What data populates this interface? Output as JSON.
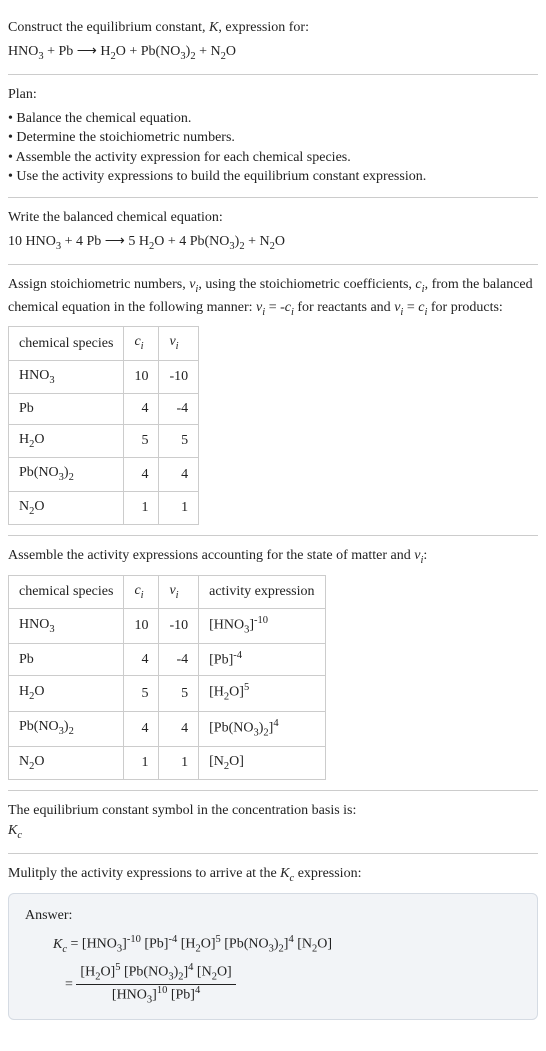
{
  "prompt": {
    "line1": "Construct the equilibrium constant, K, expression for:",
    "equation": "HNO₃ + Pb ⟶ H₂O + Pb(NO₃)₂ + N₂O"
  },
  "plan": {
    "heading": "Plan:",
    "items": [
      "Balance the chemical equation.",
      "Determine the stoichiometric numbers.",
      "Assemble the activity expression for each chemical species.",
      "Use the activity expressions to build the equilibrium constant expression."
    ]
  },
  "balanced": {
    "heading": "Write the balanced chemical equation:",
    "equation": "10 HNO₃ + 4 Pb ⟶ 5 H₂O + 4 Pb(NO₃)₂ + N₂O"
  },
  "stoich": {
    "heading_a": "Assign stoichiometric numbers, νᵢ, using the stoichiometric coefficients, cᵢ, from the balanced chemical equation in the following manner: νᵢ = -cᵢ for reactants and νᵢ = cᵢ for products:",
    "headers": [
      "chemical species",
      "cᵢ",
      "νᵢ"
    ],
    "rows": [
      {
        "species": "HNO₃",
        "c": "10",
        "v": "-10"
      },
      {
        "species": "Pb",
        "c": "4",
        "v": "-4"
      },
      {
        "species": "H₂O",
        "c": "5",
        "v": "5"
      },
      {
        "species": "Pb(NO₃)₂",
        "c": "4",
        "v": "4"
      },
      {
        "species": "N₂O",
        "c": "1",
        "v": "1"
      }
    ]
  },
  "activity": {
    "heading": "Assemble the activity expressions accounting for the state of matter and νᵢ:",
    "headers": [
      "chemical species",
      "cᵢ",
      "νᵢ",
      "activity expression"
    ],
    "rows": [
      {
        "species": "HNO₃",
        "c": "10",
        "v": "-10",
        "expr": "[HNO₃]⁻¹⁰"
      },
      {
        "species": "Pb",
        "c": "4",
        "v": "-4",
        "expr": "[Pb]⁻⁴"
      },
      {
        "species": "H₂O",
        "c": "5",
        "v": "5",
        "expr": "[H₂O]⁵"
      },
      {
        "species": "Pb(NO₃)₂",
        "c": "4",
        "v": "4",
        "expr": "[Pb(NO₃)₂]⁴"
      },
      {
        "species": "N₂O",
        "c": "1",
        "v": "1",
        "expr": "[N₂O]"
      }
    ]
  },
  "symbol": {
    "heading": "The equilibrium constant symbol in the concentration basis is:",
    "value": "K_c"
  },
  "multiply": {
    "heading": "Mulitply the activity expressions to arrive at the K_c expression:"
  },
  "answer": {
    "label": "Answer:",
    "line1": "K_c = [HNO₃]⁻¹⁰ [Pb]⁻⁴ [H₂O]⁵ [Pb(NO₃)₂]⁴ [N₂O]",
    "frac_num": "[H₂O]⁵ [Pb(NO₃)₂]⁴ [N₂O]",
    "frac_den": "[HNO₃]¹⁰ [Pb]⁴"
  }
}
